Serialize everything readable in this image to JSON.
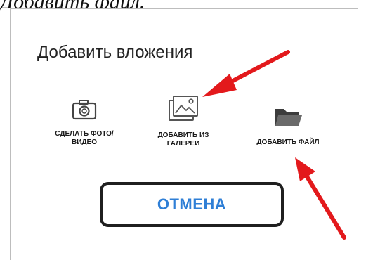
{
  "caption": "Добавить файл.",
  "dialog": {
    "title": "Добавить вложения",
    "options": [
      {
        "label": "СДЕЛАТЬ ФОТО/ ВИДЕО",
        "icon": "camera-icon"
      },
      {
        "label": "ДОБАВИТЬ ИЗ ГАЛЕРЕИ",
        "icon": "gallery-icon"
      },
      {
        "label": "ДОБАВИТЬ ФАЙЛ",
        "icon": "folder-icon"
      }
    ],
    "cancel_label": "ОТМЕНА"
  },
  "colors": {
    "cancel_text": "#2f7fd6",
    "arrow": "#e3191c",
    "border": "#1f1f1f"
  }
}
